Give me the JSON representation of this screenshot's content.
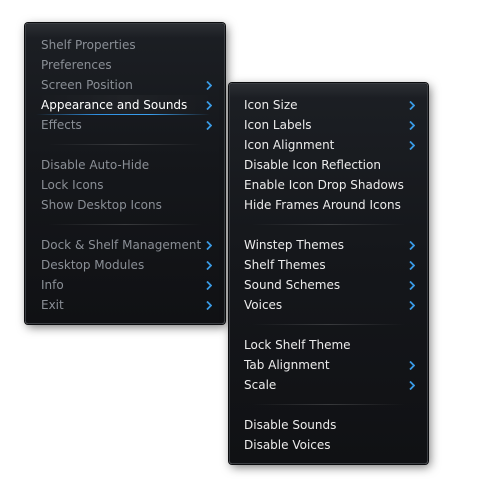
{
  "main_menu": {
    "items": [
      {
        "label": "Shelf Properties"
      },
      {
        "label": "Preferences"
      },
      {
        "label": "Screen Position"
      },
      {
        "label": "Appearance and Sounds"
      },
      {
        "label": "Effects"
      },
      {
        "label": "Disable Auto-Hide"
      },
      {
        "label": "Lock Icons"
      },
      {
        "label": "Show Desktop Icons"
      },
      {
        "label": "Dock & Shelf Management"
      },
      {
        "label": "Desktop Modules"
      },
      {
        "label": "Info"
      },
      {
        "label": "Exit"
      }
    ]
  },
  "sub_menu": {
    "items": [
      {
        "label": "Icon Size"
      },
      {
        "label": "Icon Labels"
      },
      {
        "label": "Icon Alignment"
      },
      {
        "label": "Disable Icon Reflection"
      },
      {
        "label": "Enable Icon Drop Shadows"
      },
      {
        "label": "Hide Frames Around Icons"
      },
      {
        "label": "Winstep Themes"
      },
      {
        "label": "Shelf Themes"
      },
      {
        "label": "Sound Schemes"
      },
      {
        "label": "Voices"
      },
      {
        "label": "Lock Shelf Theme"
      },
      {
        "label": "Tab Alignment"
      },
      {
        "label": "Scale"
      },
      {
        "label": "Disable Sounds"
      },
      {
        "label": "Disable Voices"
      }
    ]
  },
  "colors": {
    "menu_background": "#16181c",
    "text_disabled": "#8a8f96",
    "text_enabled": "#ececec",
    "arrow_blue": "#3a9be6",
    "hover_underline": "#2f8fe0"
  },
  "icons": {
    "submenu_arrow": "chevron-right-icon"
  }
}
